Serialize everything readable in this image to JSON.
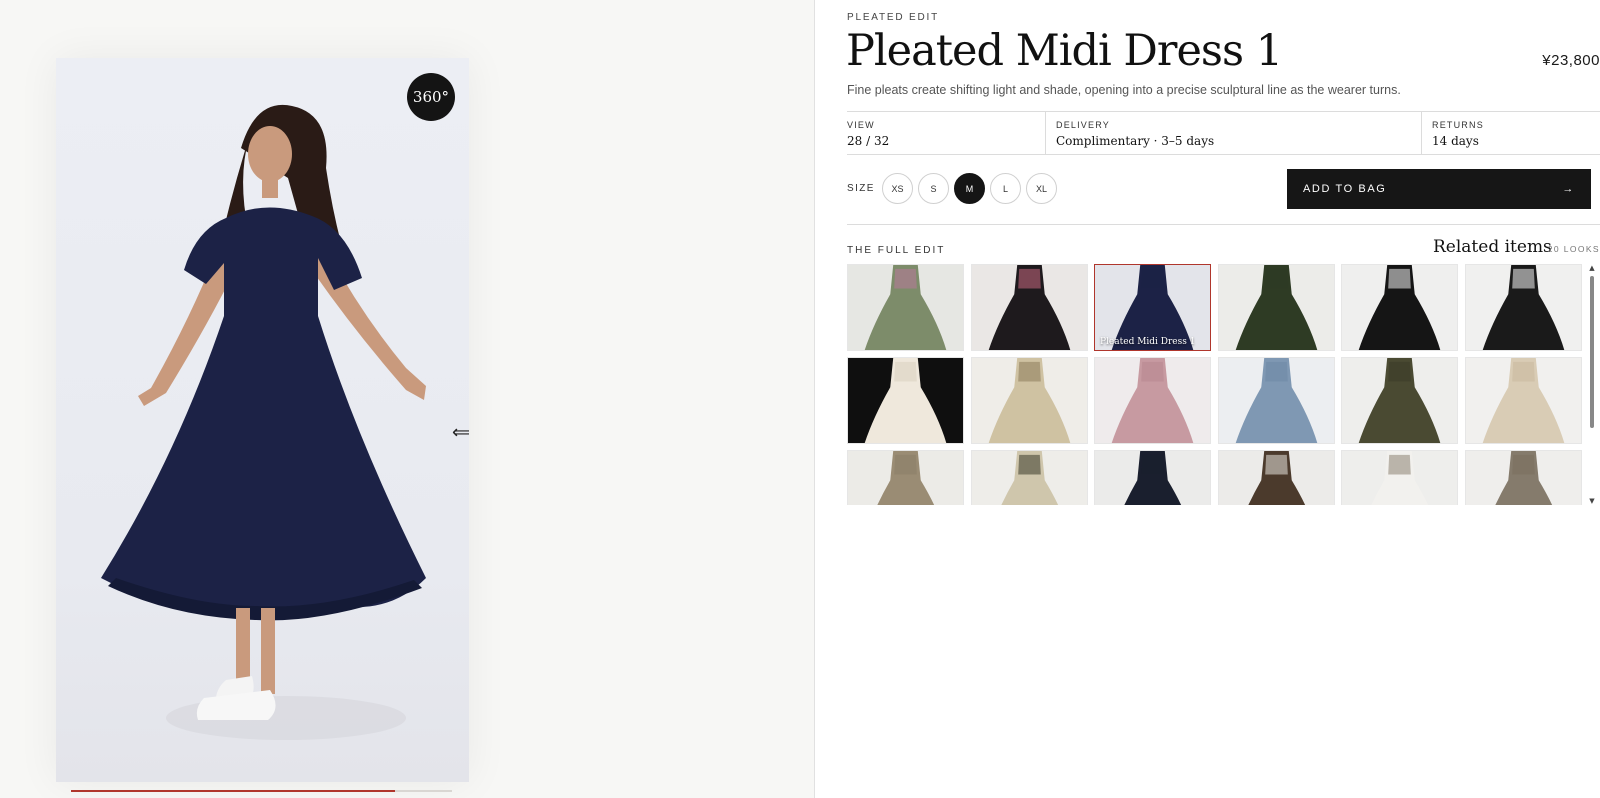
{
  "viewer": {
    "badge": "360°",
    "progress": 0.85
  },
  "product": {
    "eyebrow": "PLEATED EDIT",
    "title": "Pleated Midi Dress 1",
    "price": "¥23,800",
    "description": "Fine pleats create shifting light and shade, opening into a precise sculptural line as the wearer turns."
  },
  "info": [
    {
      "label": "VIEW",
      "value": "28 / 32"
    },
    {
      "label": "DELIVERY",
      "value": "Complimentary · 3–5 days"
    },
    {
      "label": "RETURNS",
      "value": "14 days"
    }
  ],
  "size": {
    "label": "SIZE",
    "options": [
      "XS",
      "S",
      "M",
      "L",
      "XL"
    ],
    "selected": "M"
  },
  "cta": {
    "label": "ADD TO BAG",
    "arrow": "→"
  },
  "related": {
    "section_label": "THE FULL EDIT",
    "title": "Related items",
    "count": "20 LOOKS",
    "selected_caption": "Pleated Midi Dress 1",
    "tiles": [
      {
        "icon": "floral-green-maxi-dress",
        "bg": "#e6e7e3",
        "color": "#7d8c6a",
        "accent": "#b9789a"
      },
      {
        "icon": "black-floral-dress",
        "bg": "#eae7e5",
        "color": "#1e1a1d",
        "accent": "#c86a7f"
      },
      {
        "icon": "navy-pleated-dress",
        "bg": "#e3e4ea",
        "color": "#1c2246",
        "accent": "#1c2246"
      },
      {
        "icon": "dark-green-dress",
        "bg": "#ecece9",
        "color": "#2e3b24",
        "accent": "#2e3b24"
      },
      {
        "icon": "black-tiered-skirt",
        "bg": "#efefee",
        "color": "#151515",
        "accent": "#f3f3f3"
      },
      {
        "icon": "black-skirt-white-blouse",
        "bg": "#f0f0ef",
        "color": "#1a1a1a",
        "accent": "#f6f6f6"
      },
      {
        "icon": "white-tiered-skirt",
        "bg": "#0f0f0f",
        "color": "#efe8dc",
        "accent": "#d9cfc0"
      },
      {
        "icon": "beige-lace-skirt",
        "bg": "#efede8",
        "color": "#cfc2a2",
        "accent": "#8c7c5a"
      },
      {
        "icon": "pink-tulle-gown",
        "bg": "#efebec",
        "color": "#c79aa1",
        "accent": "#b78790"
      },
      {
        "icon": "blue-tulle-gown",
        "bg": "#eceef1",
        "color": "#7f98b3",
        "accent": "#6e88a4"
      },
      {
        "icon": "olive-suit",
        "bg": "#eeeeec",
        "color": "#4a4a32",
        "accent": "#3b3b28"
      },
      {
        "icon": "cream-suit",
        "bg": "#f1f0ee",
        "color": "#d9ccb5",
        "accent": "#c8b89c"
      },
      {
        "icon": "khaki-set",
        "bg": "#ecebe7",
        "color": "#9a8c74",
        "accent": "#8b7e67"
      },
      {
        "icon": "varsity-jersey",
        "bg": "#eeede9",
        "color": "#cfc6ac",
        "accent": "#3b3a2a"
      },
      {
        "icon": "navy-suit",
        "bg": "#ebebea",
        "color": "#1a1f2e",
        "accent": "#1a1f2e"
      },
      {
        "icon": "brown-blazer",
        "bg": "#ecebe9",
        "color": "#4b3a2c",
        "accent": "#e8e4de"
      },
      {
        "icon": "white-tee-taupe-trousers",
        "bg": "#eeeeec",
        "color": "#f2f1ee",
        "accent": "#8d8273"
      },
      {
        "icon": "taupe-sweater",
        "bg": "#efeeec",
        "color": "#857b6c",
        "accent": "#7a705f"
      }
    ]
  },
  "colors": {
    "accent": "#b0362c",
    "ink": "#161616",
    "navy_dress": "#1c2246"
  }
}
